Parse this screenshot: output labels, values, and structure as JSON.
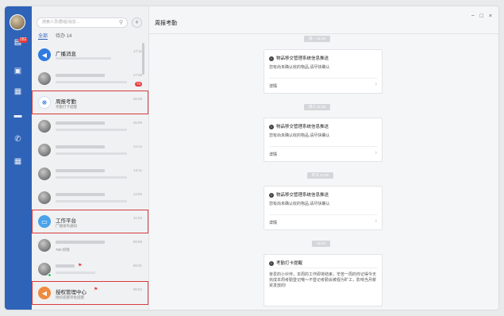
{
  "rail": {
    "badge": "282",
    "icons": [
      "chat-icon",
      "contacts-icon",
      "calendar-icon",
      "docs-icon",
      "phone-icon",
      "apps-icon"
    ]
  },
  "list": {
    "search_placeholder": "搜索人员/群组/消息...",
    "tabs": [
      {
        "label": "全部"
      },
      {
        "label": "待办 14"
      }
    ],
    "rows": [
      {
        "name": "广播消息",
        "sub": "",
        "time": "17:11"
      },
      {
        "name": "",
        "sub": "",
        "time": "17:05",
        "count": "73"
      },
      {
        "name": "周报考勤",
        "sub": "考勤打卡提醒",
        "time": "15:03"
      },
      {
        "name": "",
        "sub": "",
        "time": "15:00"
      },
      {
        "name": "",
        "sub": "",
        "time": "14:14"
      },
      {
        "name": "",
        "sub": "",
        "time": "13:11"
      },
      {
        "name": "",
        "sub": "",
        "time": "13:02"
      },
      {
        "name": "工作平台",
        "sub": "广播发布通知",
        "time": "11:02"
      },
      {
        "name": "",
        "sub": "780 权限",
        "time": "09:00"
      },
      {
        "name": "",
        "sub": "",
        "time": "09:01"
      },
      {
        "name": "授权管理中心",
        "sub": "授权提醒审批提醒",
        "time": "08:02"
      }
    ]
  },
  "pane": {
    "title": "周报考勤",
    "window_controls": [
      "−",
      "□",
      "×"
    ],
    "messages": [
      {
        "stamp": "周一 11:00",
        "title": "物品移交管理系统信息推送",
        "body": "您有尚未确认收的物品,请尽快确认",
        "link": "详情"
      },
      {
        "stamp": "周三 11:00",
        "title": "物品移交管理系统信息推送",
        "body": "您有尚未确认收的物品,请尽快确认",
        "link": "详情"
      },
      {
        "stamp": "昨天 11:00",
        "title": "物品移交管理系统信息推送",
        "body": "您有尚未确认收的物品,请尽快确认",
        "link": "详情"
      },
      {
        "stamp": "15:24",
        "title": "考勤打卡提醒",
        "body": "亲爱的小伙伴，本周的工作即将结束，辛苦一周的你记得今天完成本周考勤登记哦～不登记考勤会被视为旷工，影响当月薪资发放的!",
        "link": ""
      }
    ]
  }
}
